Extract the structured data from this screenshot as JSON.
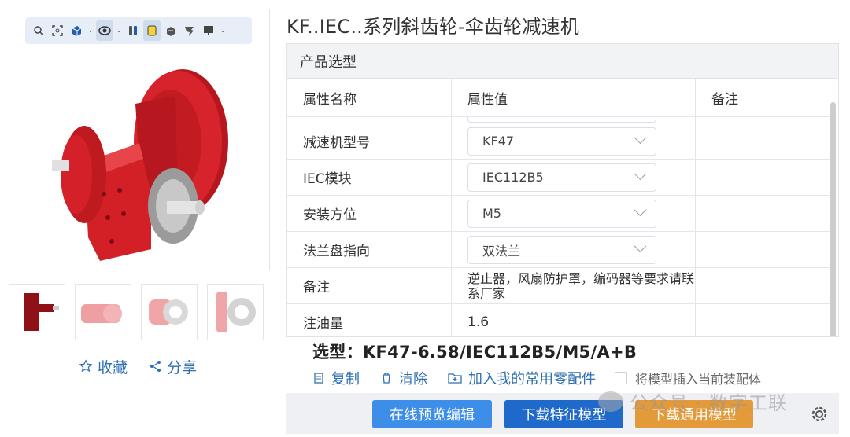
{
  "viewer": {
    "toolbar_icons": [
      "zoom-icon",
      "fit-icon",
      "cube-icon",
      "view-icon",
      "explode-icon",
      "box-solid-icon",
      "box-wire-icon",
      "pin-icon",
      "monitor-icon"
    ],
    "body_color": "#d51f26"
  },
  "left_actions": {
    "favorite": "收藏",
    "share": "分享"
  },
  "title": "KF..IEC..系列斜齿轮-伞齿轮减速机",
  "panel": {
    "header": "产品选型",
    "columns": [
      "属性名称",
      "属性值",
      "备注"
    ],
    "rows": [
      {
        "name": "减速机型号",
        "value": "KF47"
      },
      {
        "name": "IEC模块",
        "value": "IEC112B5"
      },
      {
        "name": "安装方位",
        "value": "M5"
      },
      {
        "name": "法兰盘指向",
        "value": "双法兰"
      },
      {
        "name": "备注",
        "text": "逆止器，风扇防护罩，编码器等要求请联系厂家"
      },
      {
        "name": "注油量",
        "text": "1.6"
      }
    ]
  },
  "selection": "选型：KF47-6.58/IEC112B5/M5/A+B",
  "ops": {
    "copy": "复制",
    "clear": "清除",
    "add": "加入我的常用零配件",
    "insert": "将模型插入当前装配体"
  },
  "buttons": {
    "preview": "在线预览编辑",
    "feature": "下载特征模型",
    "generic": "下载通用模型"
  },
  "watermark": "公众号 · 数字工联",
  "colors": {
    "link": "#2f6fb2",
    "btn_blue": "#3d8ee8",
    "btn_dark": "#1e69c9",
    "btn_orange": "#e39a3a"
  }
}
